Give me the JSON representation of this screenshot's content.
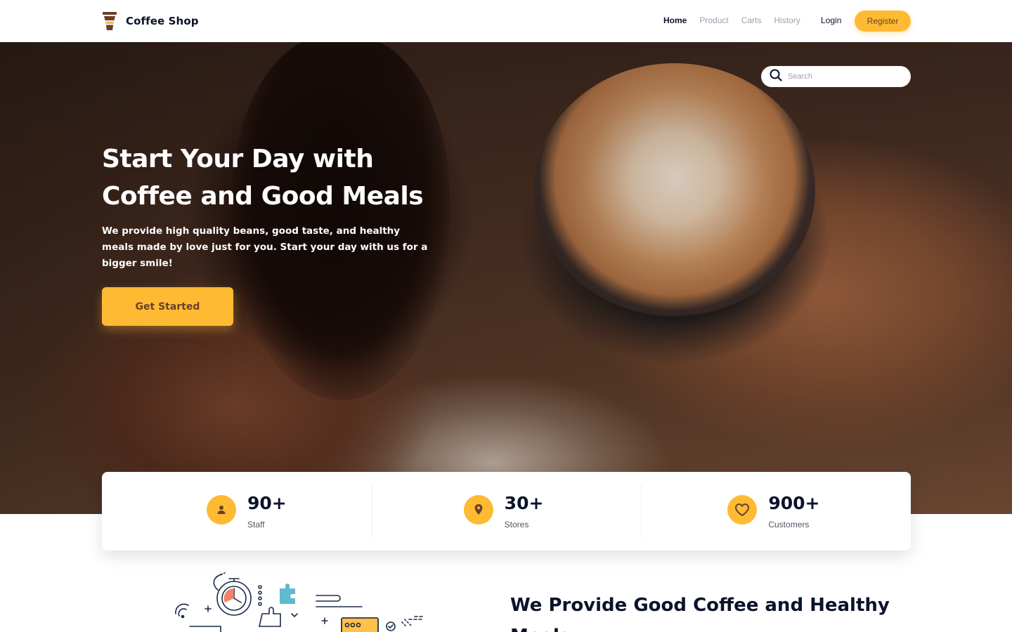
{
  "header": {
    "brand": "Coffee Shop",
    "logo_icon": "coffee-cup-icon",
    "nav": [
      {
        "label": "Home",
        "active": true
      },
      {
        "label": "Product",
        "active": false
      },
      {
        "label": "Carts",
        "active": false
      },
      {
        "label": "History",
        "active": false
      }
    ],
    "login_label": "Login",
    "register_label": "Register"
  },
  "hero": {
    "search_placeholder": "Search",
    "title_line1": "Start Your Day with",
    "title_line2": "Coffee and Good Meals",
    "subtitle": "We provide high quality beans, good taste, and healthy meals made by love just for you. Start your day with us for a bigger smile!",
    "cta_label": "Get Started"
  },
  "stats": [
    {
      "value": "90+",
      "label": "Staff",
      "icon": "person-icon"
    },
    {
      "value": "30+",
      "label": "Stores",
      "icon": "location-pin-icon"
    },
    {
      "value": "900+",
      "label": "Customers",
      "icon": "heart-icon"
    }
  ],
  "section": {
    "title": "We Provide Good Coffee and Healthy Meals"
  },
  "colors": {
    "accent": "#ffba33",
    "accent_text": "#6a4029",
    "dark_text": "#0b132a",
    "muted": "#9aa0ac"
  }
}
